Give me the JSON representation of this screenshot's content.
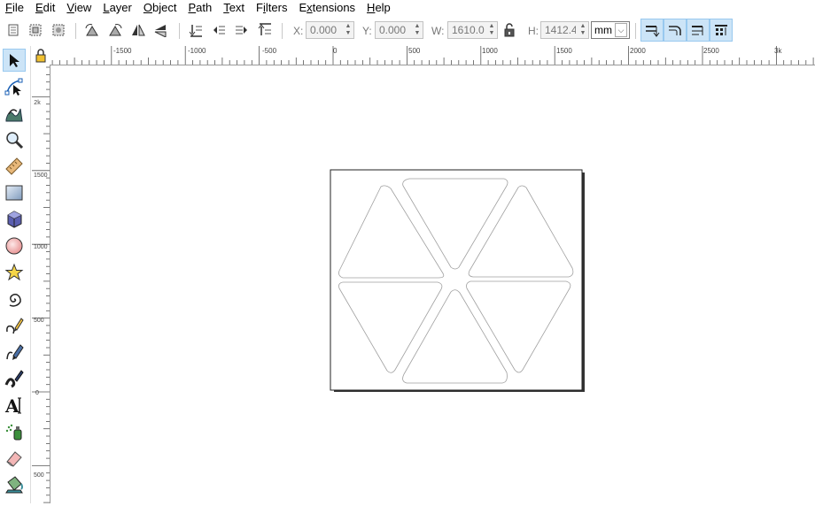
{
  "menu": {
    "items": [
      "File",
      "Edit",
      "View",
      "Layer",
      "Object",
      "Path",
      "Text",
      "Filters",
      "Extensions",
      "Help"
    ],
    "mnemonics": [
      "F",
      "E",
      "V",
      "L",
      "O",
      "P",
      "T",
      "i",
      "x",
      "H"
    ]
  },
  "toolbar": {
    "x_label": "X:",
    "x_value": "0.000",
    "y_label": "Y:",
    "y_value": "0.000",
    "w_label": "W:",
    "w_value": "1610.01",
    "h_label": "H:",
    "h_value": "1412.46",
    "unit": "mm"
  },
  "ruler_h": {
    "labels": [
      "-1500",
      "-1000",
      "-500",
      "0",
      "500",
      "1000",
      "1500",
      "2000",
      "2500",
      "3k"
    ]
  },
  "ruler_v": {
    "labels": [
      "2k",
      "1500",
      "1000",
      "500",
      "0",
      "500"
    ]
  },
  "tools": [
    "selector-tool",
    "node-tool",
    "tweak-tool",
    "zoom-tool",
    "measure-tool",
    "rectangle-tool",
    "3dbox-tool",
    "ellipse-tool",
    "star-tool",
    "spiral-tool",
    "pencil-tool",
    "pen-tool",
    "calligraphy-tool",
    "text-tool",
    "spray-tool",
    "eraser-tool",
    "paint-bucket-tool"
  ],
  "colors": {
    "accent_bg": "#cce4f7",
    "accent_border": "#99c9ef",
    "shape_stroke": "#a0a0a0"
  }
}
